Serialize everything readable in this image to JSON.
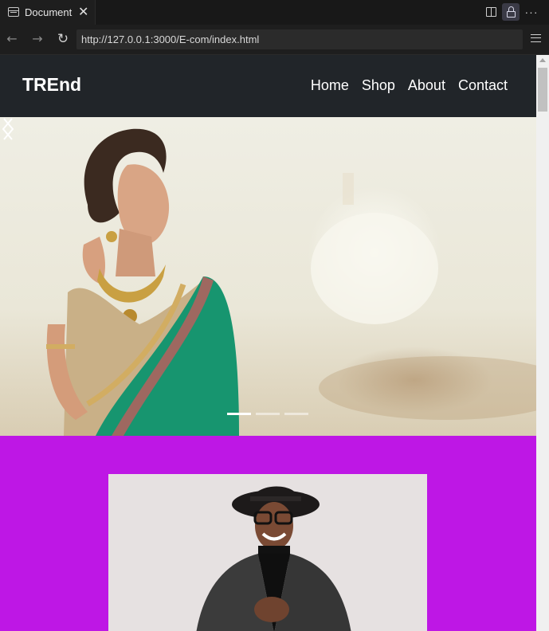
{
  "browser": {
    "tab_title": "Document",
    "tab_close": "✕",
    "url": "http://127.0.0.1:3000/E-com/index.html",
    "icons": [
      "document-icon",
      "close-icon",
      "split-view-icon",
      "lock-icon",
      "more-icon",
      "back-icon",
      "forward-icon",
      "reload-icon",
      "menu-icon"
    ]
  },
  "site": {
    "brand": "TREnd",
    "nav": [
      {
        "label": "Home"
      },
      {
        "label": "Shop"
      },
      {
        "label": "About"
      },
      {
        "label": "Contact"
      }
    ]
  },
  "carousel": {
    "slide_count": 3,
    "active_slide": 1
  },
  "colors": {
    "navbar_bg": "#212529",
    "promo_bg": "#be17e5",
    "card_bg": "#e6e1e1"
  }
}
